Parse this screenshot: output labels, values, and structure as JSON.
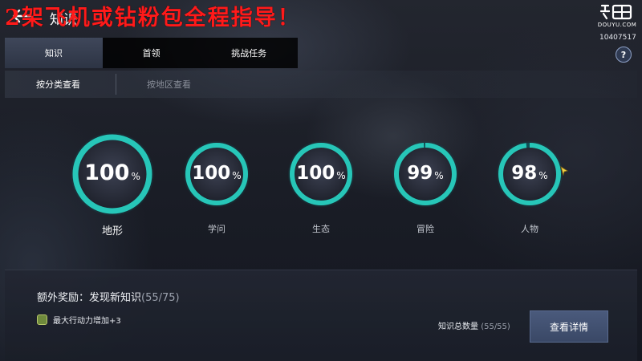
{
  "watermark": "2架飞机或钻粉包全程指导！",
  "header": {
    "title": "知识",
    "logo_text": "DOUYU.COM",
    "room_id": "10407517",
    "help_icon": "?"
  },
  "tabs": [
    {
      "label": "知识",
      "active": true
    },
    {
      "label": "首领",
      "active": false
    },
    {
      "label": "挑战任务",
      "active": false
    }
  ],
  "subtabs": [
    {
      "label": "按分类查看",
      "active": true
    },
    {
      "label": "按地区查看",
      "active": false
    }
  ],
  "categories": [
    {
      "label": "地形",
      "percent": 100,
      "percent_text": "100",
      "unit": "%",
      "selected": true
    },
    {
      "label": "学问",
      "percent": 100,
      "percent_text": "100",
      "unit": "%",
      "selected": false
    },
    {
      "label": "生态",
      "percent": 100,
      "percent_text": "100",
      "unit": "%",
      "selected": false
    },
    {
      "label": "冒险",
      "percent": 99,
      "percent_text": "99",
      "unit": "%",
      "selected": false
    },
    {
      "label": "人物",
      "percent": 98,
      "percent_text": "98",
      "unit": "%",
      "selected": false
    }
  ],
  "bonus": {
    "title": "额外奖励：发现新知识",
    "count": "(55/75)",
    "reward": "最大行动力增加+3"
  },
  "total": {
    "label": "知识总数量",
    "count": "(55/55)"
  },
  "detail_button": "查看详情",
  "colors": {
    "ring": "#27c6b8",
    "ring_dark": "#0f4e55",
    "button": "#3a4866"
  }
}
